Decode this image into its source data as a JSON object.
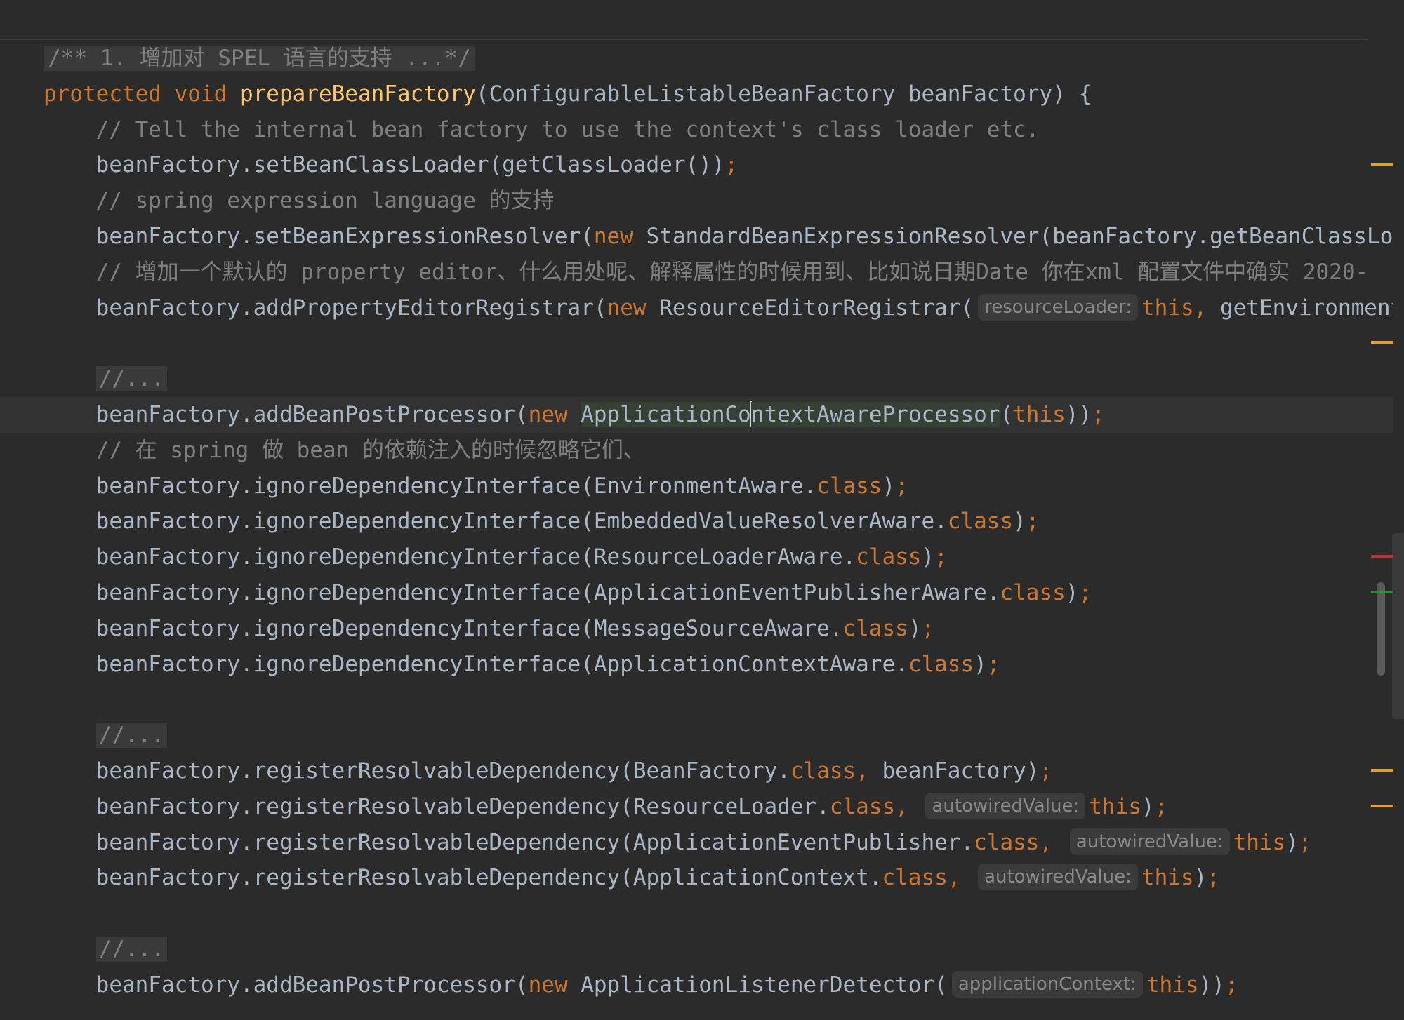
{
  "editor": {
    "lines": [
      {
        "tokens": [
          {
            "t": "/** 1. 增加对 SPEL 语言的支持 ...*/",
            "c": "fold-plain"
          }
        ]
      },
      {
        "tokens": [
          {
            "t": "protected ",
            "c": "kw"
          },
          {
            "t": "void ",
            "c": "kw"
          },
          {
            "t": "prepareBeanFactory",
            "c": "fn"
          },
          {
            "t": "(ConfigurableListableBeanFactory beanFactory) {",
            "c": "tx"
          }
        ]
      },
      {
        "tokens": [
          {
            "t": "    // Tell the internal bean factory to use the context's class loader etc.",
            "c": "cm"
          }
        ]
      },
      {
        "tokens": [
          {
            "t": "    beanFactory.setBeanClassLoader(getClassLoader())",
            "c": "tx"
          },
          {
            "t": ";",
            "c": "kw"
          }
        ]
      },
      {
        "tokens": [
          {
            "t": "    // spring expression language 的支持",
            "c": "cm"
          }
        ]
      },
      {
        "tokens": [
          {
            "t": "    beanFactory.setBeanExpressionResolver(",
            "c": "tx"
          },
          {
            "t": "new ",
            "c": "kw"
          },
          {
            "t": "StandardBeanExpressionResolver(beanFactory.getBeanClassLoad",
            "c": "tx"
          }
        ]
      },
      {
        "tokens": [
          {
            "t": "    // 增加一个默认的 property editor、什么用处呢、解释属性的时候用到、比如说日期Date 你在xml 配置文件中确实 2020-",
            "c": "cm"
          }
        ]
      },
      {
        "tokens": [
          {
            "t": "    beanFactory.addPropertyEditorRegistrar(",
            "c": "tx"
          },
          {
            "t": "new ",
            "c": "kw"
          },
          {
            "t": "ResourceEditorRegistrar(",
            "c": "tx"
          },
          {
            "t": "resourceLoader:",
            "c": "hint"
          },
          {
            "t": "this, ",
            "c": "kw"
          },
          {
            "t": "getEnvironment",
            "c": "tx"
          }
        ]
      },
      {
        "tokens": []
      },
      {
        "tokens": [
          {
            "t": "    ",
            "c": "tx"
          },
          {
            "t": "//...",
            "c": "fold"
          }
        ]
      },
      {
        "current": true,
        "tokens": [
          {
            "t": "    beanFactory.addBeanPostProcessor(",
            "c": "tx"
          },
          {
            "t": "new ",
            "c": "kw"
          },
          {
            "t": "ApplicationCo",
            "c": "hl"
          },
          {
            "t": "",
            "c": "caret"
          },
          {
            "t": "ntextAwareProcessor",
            "c": "hl"
          },
          {
            "t": "(",
            "c": "tx"
          },
          {
            "t": "this",
            "c": "kw"
          },
          {
            "t": "))",
            "c": "tx"
          },
          {
            "t": ";",
            "c": "kw"
          }
        ]
      },
      {
        "tokens": [
          {
            "t": "    // 在 spring 做 bean 的依赖注入的时候忽略它们、",
            "c": "cm"
          }
        ]
      },
      {
        "tokens": [
          {
            "t": "    beanFactory.ignoreDependencyInterface(EnvironmentAware.",
            "c": "tx"
          },
          {
            "t": "class",
            "c": "kw"
          },
          {
            "t": ")",
            "c": "tx"
          },
          {
            "t": ";",
            "c": "kw"
          }
        ]
      },
      {
        "tokens": [
          {
            "t": "    beanFactory.ignoreDependencyInterface(EmbeddedValueResolverAware.",
            "c": "tx"
          },
          {
            "t": "class",
            "c": "kw"
          },
          {
            "t": ")",
            "c": "tx"
          },
          {
            "t": ";",
            "c": "kw"
          }
        ]
      },
      {
        "tokens": [
          {
            "t": "    beanFactory.ignoreDependencyInterface(ResourceLoaderAware.",
            "c": "tx"
          },
          {
            "t": "class",
            "c": "kw"
          },
          {
            "t": ")",
            "c": "tx"
          },
          {
            "t": ";",
            "c": "kw"
          }
        ]
      },
      {
        "tokens": [
          {
            "t": "    beanFactory.ignoreDependencyInterface(ApplicationEventPublisherAware.",
            "c": "tx"
          },
          {
            "t": "class",
            "c": "kw"
          },
          {
            "t": ")",
            "c": "tx"
          },
          {
            "t": ";",
            "c": "kw"
          }
        ]
      },
      {
        "tokens": [
          {
            "t": "    beanFactory.ignoreDependencyInterface(MessageSourceAware.",
            "c": "tx"
          },
          {
            "t": "class",
            "c": "kw"
          },
          {
            "t": ")",
            "c": "tx"
          },
          {
            "t": ";",
            "c": "kw"
          }
        ]
      },
      {
        "tokens": [
          {
            "t": "    beanFactory.ignoreDependencyInterface(ApplicationContextAware.",
            "c": "tx"
          },
          {
            "t": "class",
            "c": "kw"
          },
          {
            "t": ")",
            "c": "tx"
          },
          {
            "t": ";",
            "c": "kw"
          }
        ]
      },
      {
        "tokens": []
      },
      {
        "tokens": [
          {
            "t": "    ",
            "c": "tx"
          },
          {
            "t": "//...",
            "c": "fold"
          }
        ]
      },
      {
        "tokens": [
          {
            "t": "    beanFactory.registerResolvableDependency(BeanFactory.",
            "c": "tx"
          },
          {
            "t": "class, ",
            "c": "kw"
          },
          {
            "t": "beanFactory)",
            "c": "tx"
          },
          {
            "t": ";",
            "c": "kw"
          }
        ]
      },
      {
        "tokens": [
          {
            "t": "    beanFactory.registerResolvableDependency(ResourceLoader.",
            "c": "tx"
          },
          {
            "t": "class, ",
            "c": "kw"
          },
          {
            "t": "autowiredValue:",
            "c": "hint"
          },
          {
            "t": "this",
            "c": "kw"
          },
          {
            "t": ")",
            "c": "tx"
          },
          {
            "t": ";",
            "c": "kw"
          }
        ]
      },
      {
        "tokens": [
          {
            "t": "    beanFactory.registerResolvableDependency(ApplicationEventPublisher.",
            "c": "tx"
          },
          {
            "t": "class, ",
            "c": "kw"
          },
          {
            "t": "autowiredValue:",
            "c": "hint"
          },
          {
            "t": "this",
            "c": "kw"
          },
          {
            "t": ")",
            "c": "tx"
          },
          {
            "t": ";",
            "c": "kw"
          }
        ]
      },
      {
        "tokens": [
          {
            "t": "    beanFactory.registerResolvableDependency(ApplicationContext.",
            "c": "tx"
          },
          {
            "t": "class, ",
            "c": "kw"
          },
          {
            "t": "autowiredValue:",
            "c": "hint"
          },
          {
            "t": "this",
            "c": "kw"
          },
          {
            "t": ")",
            "c": "tx"
          },
          {
            "t": ";",
            "c": "kw"
          }
        ]
      },
      {
        "tokens": []
      },
      {
        "tokens": [
          {
            "t": "    ",
            "c": "tx"
          },
          {
            "t": "//...",
            "c": "fold"
          }
        ]
      },
      {
        "tokens": [
          {
            "t": "    beanFactory.addBeanPostProcessor(",
            "c": "tx"
          },
          {
            "t": "new ",
            "c": "kw"
          },
          {
            "t": "ApplicationListenerDetector(",
            "c": "tx"
          },
          {
            "t": "applicationContext:",
            "c": "hint"
          },
          {
            "t": "this",
            "c": "kw"
          },
          {
            "t": "))",
            "c": "tx"
          },
          {
            "t": ";",
            "c": "kw"
          }
        ]
      }
    ],
    "gutter_markers": [
      {
        "line": 3,
        "kind": "warn"
      },
      {
        "line": 8,
        "kind": "warn"
      },
      {
        "line": 14,
        "kind": "err"
      },
      {
        "line": 15,
        "kind": "ok"
      },
      {
        "line": 20,
        "kind": "warn"
      },
      {
        "line": 21,
        "kind": "warn"
      }
    ],
    "colors": {
      "background": "#2b2b2b",
      "keyword": "#cc7832",
      "method": "#ffc66d",
      "comment": "#808080",
      "text": "#a9b7c6"
    }
  }
}
